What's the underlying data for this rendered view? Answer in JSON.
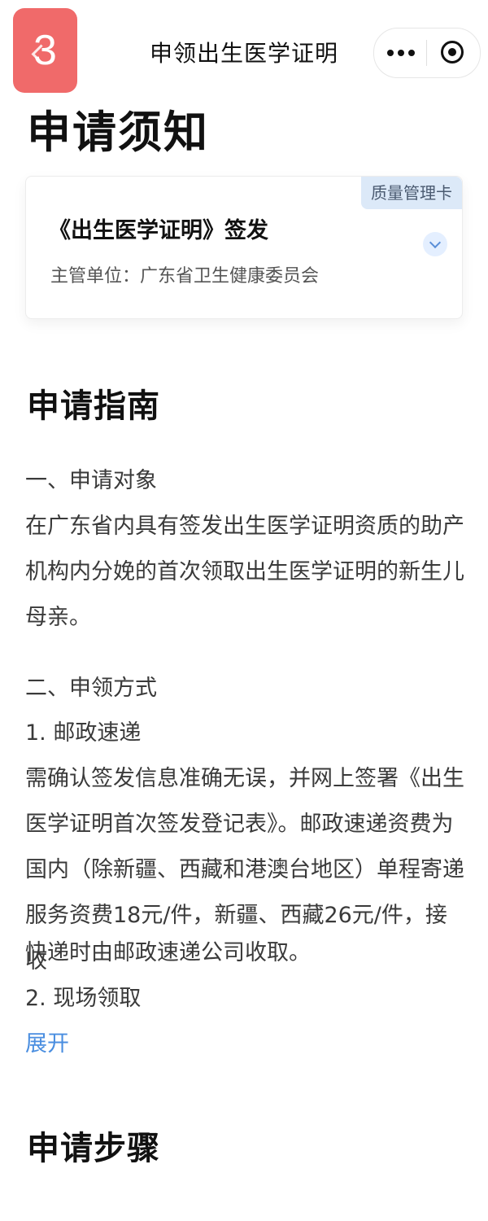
{
  "nav": {
    "step_badge": "3",
    "title": "申领出生医学证明"
  },
  "notice": {
    "heading": "申请须知",
    "card": {
      "tag": "质量管理卡",
      "title": "《出生医学证明》签发",
      "subtitle": "主管单位：广东省卫生健康委员会"
    }
  },
  "guide": {
    "heading": "申请指南",
    "section1_title": "一、申请对象",
    "section1_lines": [
      "在广东省内具有签发出生医学证明资质的助产",
      "机构内分娩的首次领取出生医学证明的新生儿",
      "母亲。"
    ],
    "section2_title": "二、申领方式",
    "method1_title": "1. 邮政速递",
    "method1_lines": [
      "需确认签发信息准确无误，并网上签署《出生",
      "医学证明首次签发登记表》。邮政速递资费为",
      "国内（除新疆、西藏和港澳台地区）单程寄递",
      "服务资费18元/件，新疆、西藏26元/件，接收",
      "快递时由邮政速递公司收取。"
    ],
    "method2_title": "2. 现场领取",
    "expand_label": "展开"
  },
  "steps": {
    "heading": "申请步骤"
  }
}
